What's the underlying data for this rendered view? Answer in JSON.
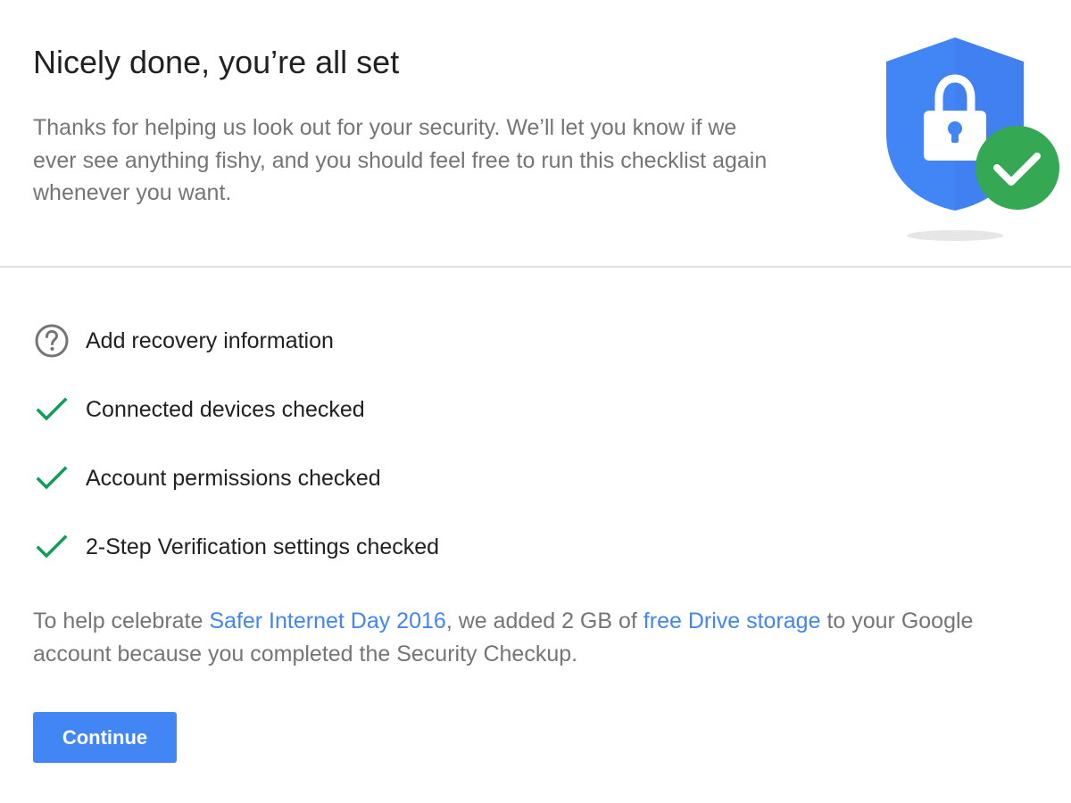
{
  "header": {
    "title": "Nicely done, you’re all set",
    "intro": "Thanks for helping us look out for your security. We’ll let you know if we ever see anything fishy, and you should feel free to run this checklist again whenever you want."
  },
  "checklist": [
    {
      "icon": "help-circle-icon",
      "label": "Add recovery information"
    },
    {
      "icon": "checkmark-icon",
      "label": "Connected devices checked"
    },
    {
      "icon": "checkmark-icon",
      "label": "Account permissions checked"
    },
    {
      "icon": "checkmark-icon",
      "label": "2-Step Verification settings checked"
    }
  ],
  "promo": {
    "text_before": "To help celebrate ",
    "link1": "Safer Internet Day 2016",
    "text_middle": ", we added 2 GB of ",
    "link2": "free Drive storage",
    "text_after": " to your Google account because you completed the Security Checkup."
  },
  "actions": {
    "continue_label": "Continue"
  },
  "colors": {
    "accent": "#4285f4",
    "success": "#34a853",
    "check": "#0f9d58",
    "secondary_text": "#757575",
    "divider": "#e0e0e0"
  },
  "illustration": {
    "icon": "security-shield-lock-icon",
    "badge_icon": "check-badge-icon"
  }
}
